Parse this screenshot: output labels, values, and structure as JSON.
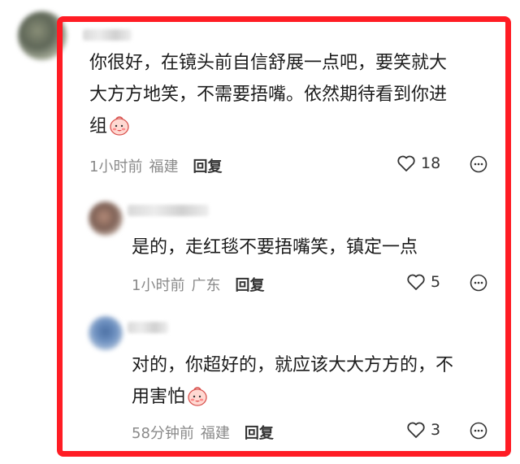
{
  "main_comment": {
    "text_line1": "你很好，在镜头前自信舒展一点吧，要笑就大",
    "text_line2": "大方方地笑，不需要捂嘴。依然期待看到你进",
    "text_line3": "组",
    "time": "1小时前",
    "location": "福建",
    "reply_label": "回复",
    "likes": "18",
    "emoji": "blushing-peach-emoji"
  },
  "replies": [
    {
      "text_line1": "是的，走红毯不要捂嘴笑，镇定一点",
      "time": "1小时前",
      "location": "广东",
      "reply_label": "回复",
      "likes": "5"
    },
    {
      "text_line1": "对的，你超好的，就应该大大方方的，不",
      "text_line2": "用害怕",
      "time": "58分钟前",
      "location": "福建",
      "reply_label": "回复",
      "likes": "3",
      "emoji": "blushing-peach-emoji"
    }
  ],
  "colors": {
    "highlight_border": "#ff1c24",
    "meta_text": "#8a8a8a"
  }
}
